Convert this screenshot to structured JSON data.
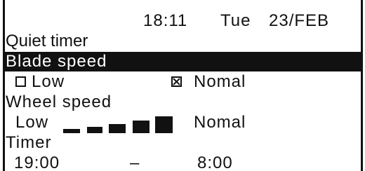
{
  "status_bar": {
    "time": "18:11",
    "day": "Tue",
    "date": "23/FEB"
  },
  "menu": {
    "quiet_timer": "Quiet timer",
    "blade_speed": {
      "title": "Blade speed",
      "options": [
        {
          "label": "Low",
          "checked": false
        },
        {
          "label": "Nomal",
          "checked": true
        }
      ]
    },
    "wheel_speed": {
      "title": "Wheel speed",
      "low_label": "Low",
      "high_label": "Nomal",
      "level_segments_filled": 5,
      "level_segments_total": 5
    },
    "timer": {
      "title": "Timer",
      "start": "19:00",
      "separator": "–",
      "end": "8:00"
    }
  }
}
